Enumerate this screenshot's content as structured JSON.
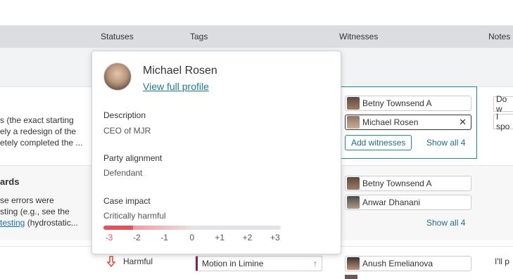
{
  "columns": {
    "statuses": "Statuses",
    "tags": "Tags",
    "witnesses": "Witnesses",
    "notes": "Notes"
  },
  "rows": [
    {
      "desc_lines": [
        "s (the exact starting",
        "ely a redesign of the",
        "etely completed the ..."
      ],
      "witnesses": [
        "Betny Townsend A",
        "Michael Rosen"
      ],
      "add_witnesses": "Add witnesses",
      "show_all": "Show all 4",
      "notes": [
        "Do w",
        "I spo"
      ]
    },
    {
      "title": "ards",
      "desc_lines": [
        "se errors were",
        "sting (e.g., see the"
      ],
      "desc_link": "testing",
      "desc_tail": " (hydrostatic...",
      "witnesses": [
        "Betny Townsend A",
        "Anwar Dhanani"
      ],
      "show_all": "Show all 4"
    },
    {
      "status": "Harmful",
      "tag": "Motion in Limine",
      "witness": "Anush Emelianova",
      "note": "I'll p"
    }
  ],
  "popover": {
    "name": "Michael Rosen",
    "profile_link": "View full profile",
    "description_label": "Description",
    "description_value": "CEO of MJR",
    "alignment_label": "Party alignment",
    "alignment_value": "Defendant",
    "impact_label": "Case impact",
    "impact_value": "Critically harmful",
    "impact_score": -3,
    "scale_ticks": [
      "-3",
      "-2",
      "-1",
      "0",
      "+1",
      "+2",
      "+3"
    ]
  },
  "icons": {
    "close": "close-icon",
    "arrow_up": "arrow-up-icon",
    "harmful": "arrow-down-icon"
  },
  "colors": {
    "teal": "#1f8a93",
    "harmful": "#e0533d",
    "tag_accent": "#8a2251",
    "impact_red": "#e8505b"
  }
}
